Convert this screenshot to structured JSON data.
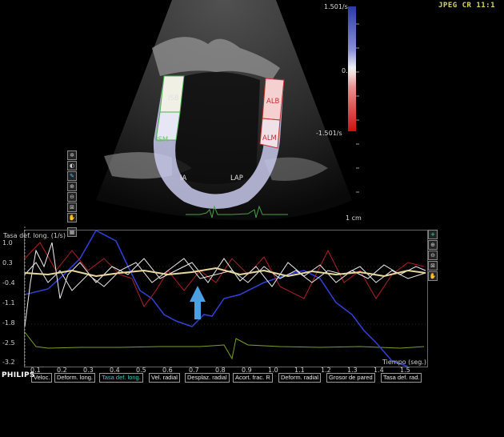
{
  "header": {
    "format_label": "JPEG CR 11:1"
  },
  "colorbar": {
    "top_label": "1.501/s",
    "mid_label": "0.00",
    "bottom_label": "-1.501/s",
    "top_color": "#3a4fb0",
    "bottom_color": "#d01818"
  },
  "segments": {
    "ism_upper": "ISB",
    "ism_lower": "ISM",
    "lat_upper": "ALB",
    "lat_lower": "ALM",
    "bottom_left": "IA",
    "bottom_right": "LAP"
  },
  "scale_label": "1 cm",
  "graph": {
    "title": "Tasa def. long. (1/s)",
    "time_label": "Tiempo (seg.)",
    "y_ticks": [
      "1.0",
      "0.3",
      "-0.4",
      "-1.1",
      "-1.8",
      "-2.5",
      "-3.2"
    ],
    "x_ticks": [
      "0.1",
      "0.2",
      "0.3",
      "0.4",
      "0.5",
      "0.6",
      "0.7",
      "0.8",
      "0.9",
      "1.0",
      "1.1",
      "1.2",
      "1.3",
      "1.4",
      "1.5"
    ],
    "arrow_color": "#4aa0e0"
  },
  "bottom": {
    "brand": "PHILIPS",
    "tabs": [
      {
        "label": "Veloc."
      },
      {
        "label": "Deform. long."
      },
      {
        "label": "Tasa def. long."
      },
      {
        "label": "Vel. radial"
      },
      {
        "label": "Desplaz. radial"
      },
      {
        "label": "Acort. frac. R"
      },
      {
        "label": "Deform. radial"
      },
      {
        "label": "Grosor de pared"
      },
      {
        "label": "Tasa def. rad."
      }
    ],
    "active_tab": "Tasa def. long."
  }
}
